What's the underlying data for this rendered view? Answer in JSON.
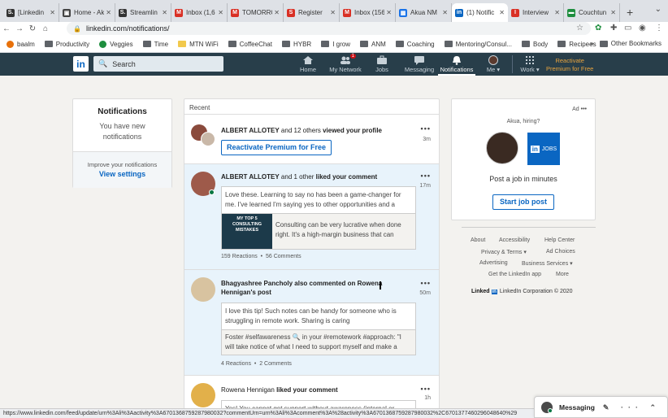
{
  "browser": {
    "tabs": [
      {
        "title": "[Linkedin",
        "favicon_color": "#333333",
        "favicon_char": "S."
      },
      {
        "title": "Home - Ak",
        "favicon_color": "#444444",
        "favicon_char": "▣"
      },
      {
        "title": "Streamlin",
        "favicon_color": "#333333",
        "favicon_char": "S."
      },
      {
        "title": "Inbox (1,6",
        "favicon_color": "#d93025",
        "favicon_char": "M"
      },
      {
        "title": "TOMORRO",
        "favicon_color": "#d93025",
        "favicon_char": "M"
      },
      {
        "title": "Register",
        "favicon_color": "#d93025",
        "favicon_char": "S"
      },
      {
        "title": "Inbox (156",
        "favicon_color": "#d93025",
        "favicon_char": "M"
      },
      {
        "title": "Akua NM",
        "favicon_color": "#1a73e8",
        "favicon_char": "▦"
      },
      {
        "title": "(1) Notific",
        "favicon_color": "#0a66c2",
        "favicon_char": "in"
      },
      {
        "title": "Interview",
        "favicon_color": "#d93025",
        "favicon_char": "I"
      },
      {
        "title": "Couchtun",
        "favicon_color": "#1e8e3e",
        "favicon_char": "▬"
      }
    ],
    "url": "linkedin.com/notifications/",
    "bookmarks": [
      {
        "label": "baalm",
        "color": "#e8710a"
      },
      {
        "label": "Productivity",
        "color": "#5f6368"
      },
      {
        "label": "Veggies",
        "color": "#1e8e3e"
      },
      {
        "label": "Time",
        "color": "#5f6368"
      },
      {
        "label": "MTN WiFi",
        "color": "#f2c94c"
      },
      {
        "label": "CoffeeChat",
        "color": "#5f6368"
      },
      {
        "label": "HYBR",
        "color": "#5f6368"
      },
      {
        "label": "I grow",
        "color": "#5f6368"
      },
      {
        "label": "ANM",
        "color": "#5f6368"
      },
      {
        "label": "Coaching",
        "color": "#5f6368"
      },
      {
        "label": "Mentoring/Consul...",
        "color": "#5f6368"
      },
      {
        "label": "Body",
        "color": "#5f6368"
      },
      {
        "label": "Recipees",
        "color": "#5f6368"
      }
    ],
    "bookmarks_more": "»",
    "other_bookmarks": "Other Bookmarks",
    "status_url": "https://www.linkedin.com/feed/update/urn%3Ali%3Aactivity%3A6701368759287980032?commentUrn=urn%3Ali%3Acomment%3A%28activity%3A6701368759287980032%2C6701377460296048640%29"
  },
  "linkedin_nav": {
    "logo": "in",
    "search_placeholder": "Search",
    "items": [
      {
        "label": "Home"
      },
      {
        "label": "My Network",
        "badge": "1"
      },
      {
        "label": "Jobs"
      },
      {
        "label": "Messaging"
      },
      {
        "label": "Notifications"
      },
      {
        "label": "Me ▾"
      },
      {
        "label": "Work ▾"
      }
    ],
    "premium_line1": "Reactivate",
    "premium_line2": "Premium for Free"
  },
  "left_card": {
    "title": "Notifications",
    "subtitle": "You have new notifications",
    "improve": "Improve your notifications",
    "view_settings": "View settings"
  },
  "feed": {
    "header": "Recent",
    "items": [
      {
        "actor": "ALBERT ALLOTEY",
        "rest": " and 12 others ",
        "action": "viewed your profile",
        "time": "3m",
        "button": "Reactivate Premium for Free"
      },
      {
        "actor": "ALBERT ALLOTEY",
        "rest": " and 1 other ",
        "action": "liked your comment",
        "time": "17m",
        "comment": "Love these. Learning to say no has been a game-changer for me. I've learned I'm saying yes to other opportunities and a",
        "thumb_text": "MY TOP 5 CONSULTING MISTAKES",
        "post": "Consulting can be very lucrative when done right. It's a high-margin business that can",
        "reactions": "159 Reactions",
        "comments": "56 Comments"
      },
      {
        "actor": "Bhagyashree Pancholy",
        "rest": " ",
        "action": "also commented on Rowena Hennigan's post",
        "time": "50m",
        "comment": "I love this tip! Such notes can be handy for someone who is struggling in remote work. Sharing is caring",
        "post": "Foster #selfawareness 🔍 in your #remotework #approach: \"I will take notice of what I need to support myself and make a",
        "reactions": "4 Reactions",
        "comments": "2 Comments"
      },
      {
        "actor": "Rowena Hennigan",
        "rest": " ",
        "action": "liked your comment",
        "time": "1h",
        "comment": "Yes! You cannot get support without awareness (internal or"
      }
    ]
  },
  "ad": {
    "label": "Ad",
    "question": "Akua, hiring?",
    "logo_in": "in",
    "logo_text": "JOBS",
    "text": "Post a job in minutes",
    "button": "Start job post"
  },
  "footer": {
    "links": [
      "About",
      "Accessibility",
      "Help Center",
      "Privacy & Terms ▾",
      "Ad Choices",
      "Advertising",
      "Business Services ▾",
      "Get the LinkedIn app",
      "More"
    ],
    "brand": "Linked",
    "brand_in": "in",
    "copyright": "LinkedIn Corporation © 2020"
  },
  "messaging": {
    "label": "Messaging",
    "icons": "✎ ··· ⌃"
  }
}
